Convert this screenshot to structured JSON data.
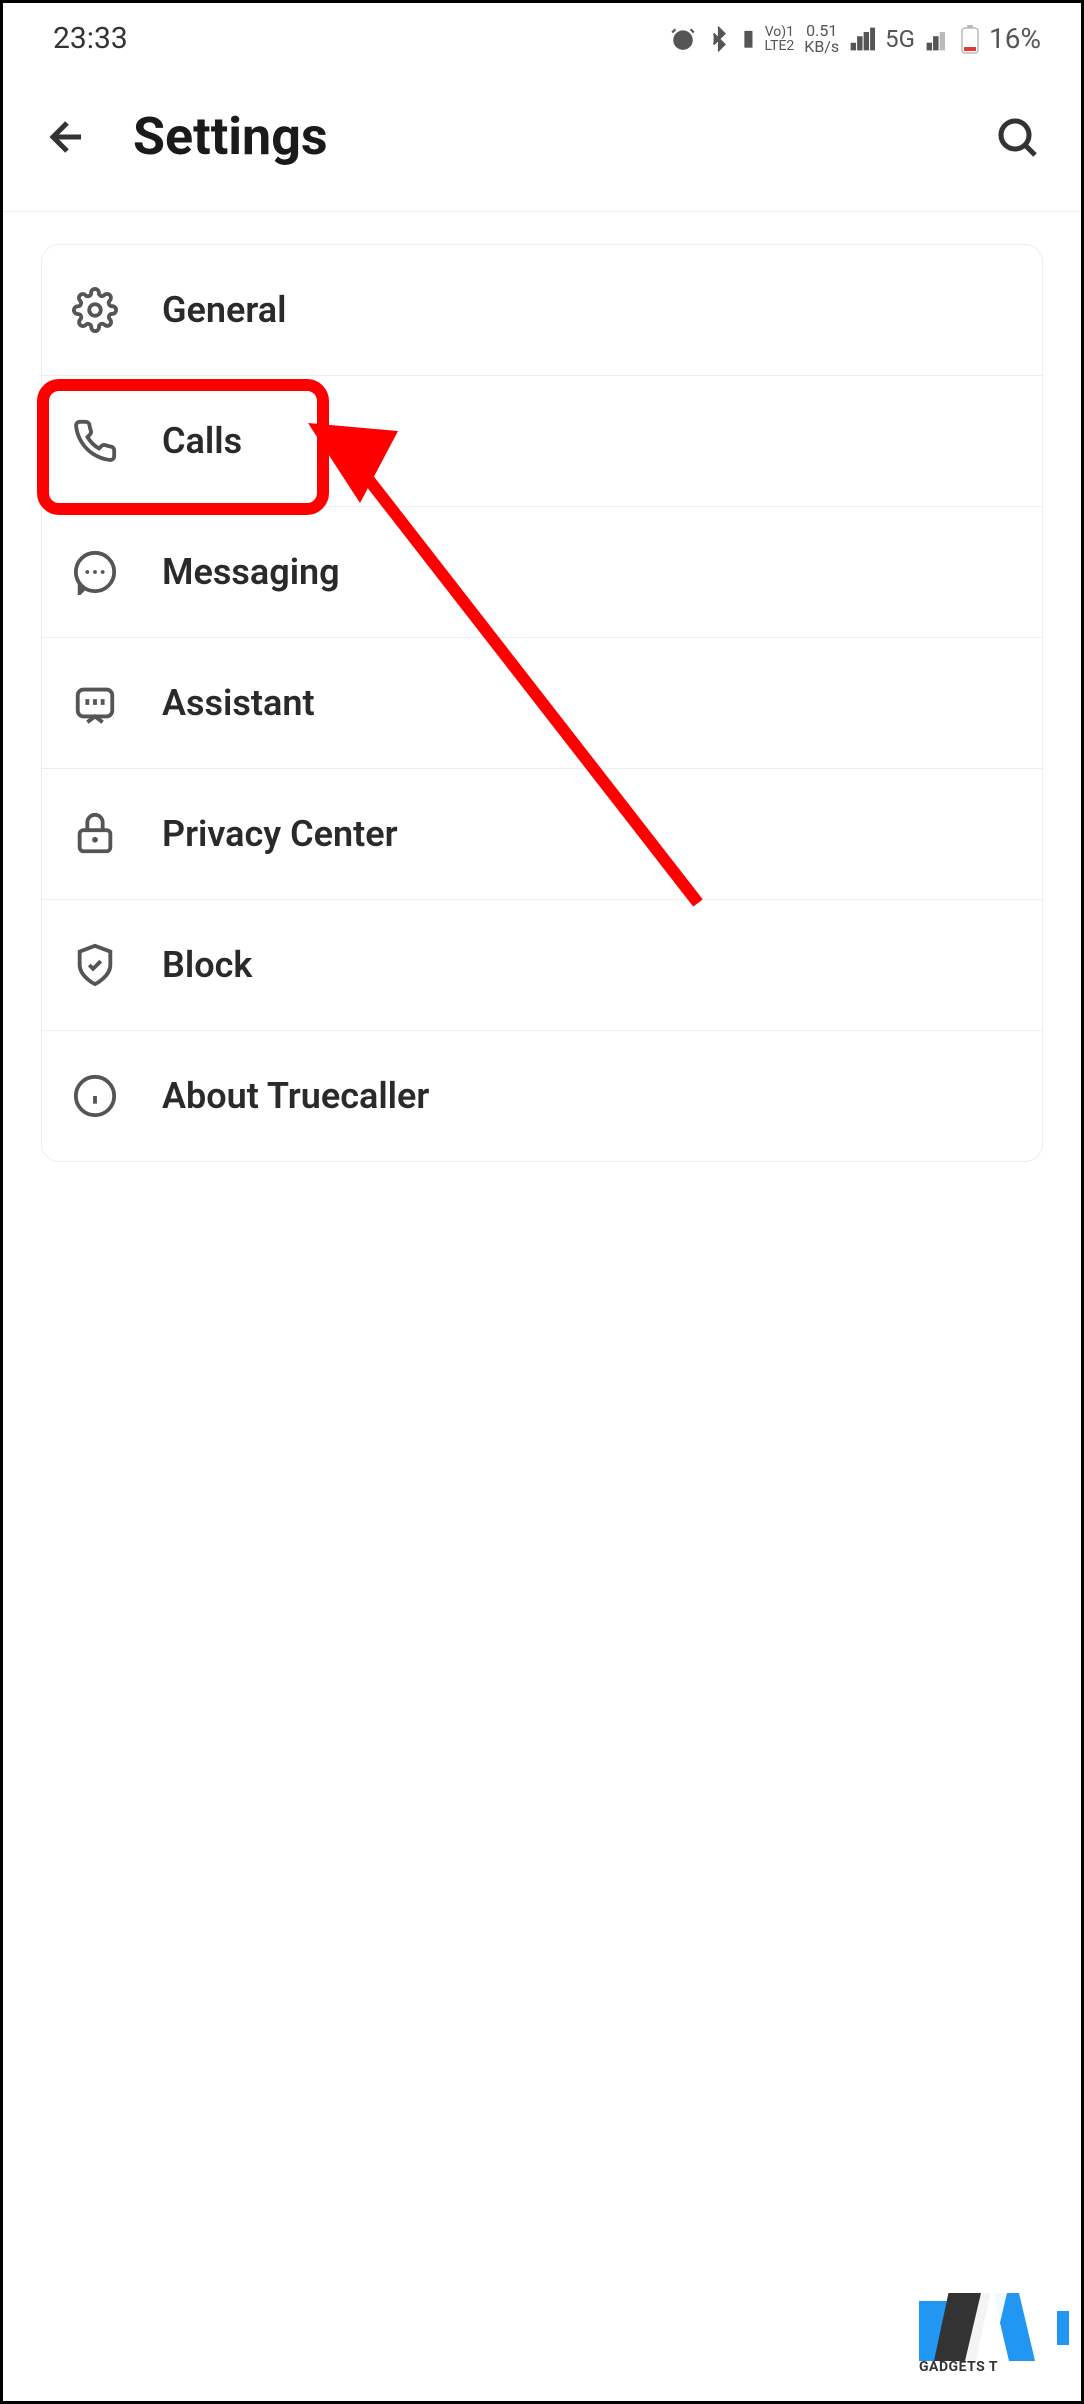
{
  "status_bar": {
    "time": "23:33",
    "network_speed_top": "0.51",
    "network_speed_bottom": "KB/s",
    "lte_top": "Vo)1",
    "lte_bottom": "LTE2",
    "network_type": "5G",
    "battery_percent": "16%"
  },
  "header": {
    "title": "Settings"
  },
  "settings": {
    "items": [
      {
        "label": "General",
        "icon": "gear-icon"
      },
      {
        "label": "Calls",
        "icon": "phone-icon"
      },
      {
        "label": "Messaging",
        "icon": "chat-icon"
      },
      {
        "label": "Assistant",
        "icon": "assistant-icon"
      },
      {
        "label": "Privacy Center",
        "icon": "lock-icon"
      },
      {
        "label": "Block",
        "icon": "shield-icon"
      },
      {
        "label": "About Truecaller",
        "icon": "info-icon"
      }
    ]
  },
  "watermark": {
    "text": "GADGETS T"
  }
}
